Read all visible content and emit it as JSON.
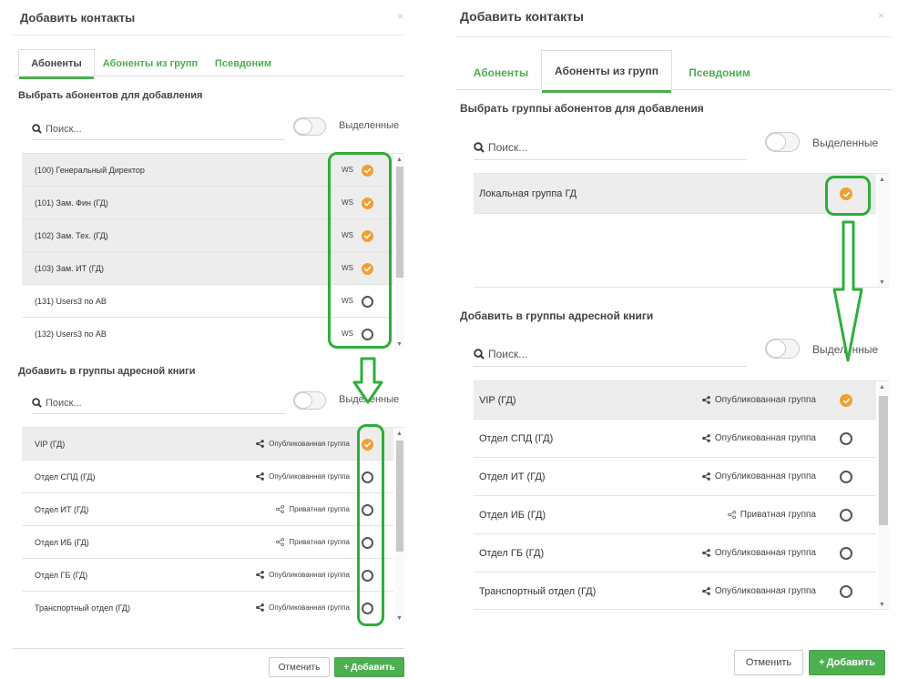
{
  "left": {
    "title": "Добавить контакты",
    "close": "×",
    "tabs": [
      "Абоненты",
      "Абоненты из групп",
      "Псевдоним"
    ],
    "section1_title": "Выбрать абонентов для добавления",
    "search_placeholder": "Поиск...",
    "toggle_label": "Выделенные",
    "subscribers": [
      {
        "name": "(100) Генеральный Директор",
        "tag": "WS",
        "checked": true
      },
      {
        "name": "(101) Зам. Фин (ГД)",
        "tag": "WS",
        "checked": true
      },
      {
        "name": "(102) Зам. Тех. (ГД)",
        "tag": "WS",
        "checked": true
      },
      {
        "name": "(103) Зам. ИТ (ГД)",
        "tag": "WS",
        "checked": true
      },
      {
        "name": "(131) Users3 по AB",
        "tag": "WS",
        "checked": false
      },
      {
        "name": "(132) Users3 по AB",
        "tag": "WS",
        "checked": false
      }
    ],
    "section2_title": "Добавить в группы адресной книги",
    "search2_placeholder": "Поиск...",
    "toggle2_label": "Выделенные",
    "groups": [
      {
        "name": "VIP (ГД)",
        "tag": "Опубликованная группа",
        "icon": "share-icon",
        "checked": true
      },
      {
        "name": "Отдел СПД (ГД)",
        "tag": "Опубликованная группа",
        "icon": "share-icon",
        "checked": false
      },
      {
        "name": "Отдел ИТ (ГД)",
        "tag": "Приватная группа",
        "icon": "share-outline-icon",
        "checked": false
      },
      {
        "name": "Отдел ИБ (ГД)",
        "tag": "Приватная группа",
        "icon": "share-outline-icon",
        "checked": false
      },
      {
        "name": "Отдел ГБ (ГД)",
        "tag": "Опубликованная группа",
        "icon": "share-icon",
        "checked": false
      },
      {
        "name": "Транспортный отдел (ГД)",
        "tag": "Опубликованная группа",
        "icon": "share-icon",
        "checked": false
      }
    ],
    "cancel": "Отменить",
    "add": "Добавить"
  },
  "right": {
    "title": "Добавить контакты",
    "close": "×",
    "tabs": [
      "Абоненты",
      "Абоненты из групп",
      "Псевдоним"
    ],
    "section1_title": "Выбрать группы абонентов для добавления",
    "search_placeholder": "Поиск...",
    "toggle_label": "Выделенные",
    "sub_groups": [
      {
        "name": "Локальная группа ГД",
        "checked": true
      }
    ],
    "section2_title": "Добавить в группы адресной книги",
    "search2_placeholder": "Поиск...",
    "toggle2_label": "Выделенные",
    "groups": [
      {
        "name": "VIP (ГД)",
        "tag": "Опубликованная группа",
        "icon": "share-icon",
        "checked": true
      },
      {
        "name": "Отдел СПД (ГД)",
        "tag": "Опубликованная группа",
        "icon": "share-icon",
        "checked": false
      },
      {
        "name": "Отдел ИТ (ГД)",
        "tag": "Опубликованная группа",
        "icon": "share-icon",
        "checked": false
      },
      {
        "name": "Отдел ИБ (ГД)",
        "tag": "Приватная группа",
        "icon": "share-outline-icon",
        "checked": false
      },
      {
        "name": "Отдел ГБ (ГД)",
        "tag": "Опубликованная группа",
        "icon": "share-icon",
        "checked": false
      },
      {
        "name": "Транспортный отдел (ГД)",
        "tag": "Опубликованная группа",
        "icon": "share-icon",
        "checked": false
      }
    ],
    "cancel": "Отменить",
    "add": "Добавить"
  },
  "colors": {
    "accent": "#4caf50",
    "check": "#f0a030",
    "annotation": "#2eae3a"
  },
  "plus": "+"
}
